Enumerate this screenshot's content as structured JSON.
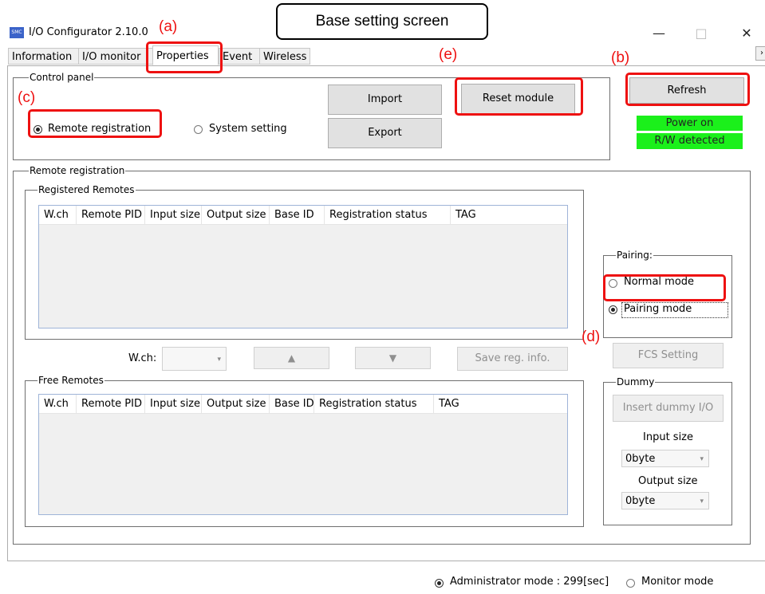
{
  "callout": "Base setting screen",
  "annotations": {
    "a": "(a)",
    "b": "(b)",
    "c": "(c)",
    "d": "(d)",
    "e": "(e)"
  },
  "window": {
    "title": "I/O Configurator 2.10.0",
    "app_icon_text": "SMC",
    "minimize": "—",
    "maximize": "□",
    "close": "✕"
  },
  "tabs": [
    "Information",
    "I/O monitor",
    "Properties",
    "Event",
    "Wireless"
  ],
  "active_tab": "Properties",
  "control_panel": {
    "label": "Control panel",
    "remote_registration": "Remote registration",
    "system_setting": "System setting",
    "import": "Import",
    "export": "Export",
    "reset_module": "Reset module",
    "refresh": "Refresh",
    "power_on": "Power on",
    "rw_detected": "R/W detected",
    "status_color": "#1bf01b"
  },
  "remote_registration": {
    "label": "Remote registration",
    "registered_label": "Registered Remotes",
    "columns": [
      "W.ch",
      "Remote PID",
      "Input size",
      "Output size",
      "Base ID",
      "Registration status",
      "TAG"
    ],
    "wch_label": "W.ch:",
    "up_arrow": "▲",
    "down_arrow": "▼",
    "save_reg_info": "Save reg. info.",
    "free_label": "Free Remotes",
    "free_columns": [
      "W.ch",
      "Remote PID",
      "Input size",
      "Output size",
      "Base ID",
      "Registration status",
      "TAG"
    ]
  },
  "pairing": {
    "label": "Pairing:",
    "normal_mode": "Normal mode",
    "pairing_mode": "Pairing mode",
    "selected": "Pairing mode"
  },
  "fcs_setting": "FCS Setting",
  "dummy": {
    "label": "Dummy",
    "insert": "Insert dummy I/O",
    "input_size_label": "Input size",
    "input_size_value": "0byte",
    "output_size_label": "Output size",
    "output_size_value": "0byte"
  },
  "statusbar": {
    "admin_mode": "Administrator mode : 299[sec]",
    "monitor_mode": "Monitor mode",
    "selected": "Administrator mode"
  }
}
